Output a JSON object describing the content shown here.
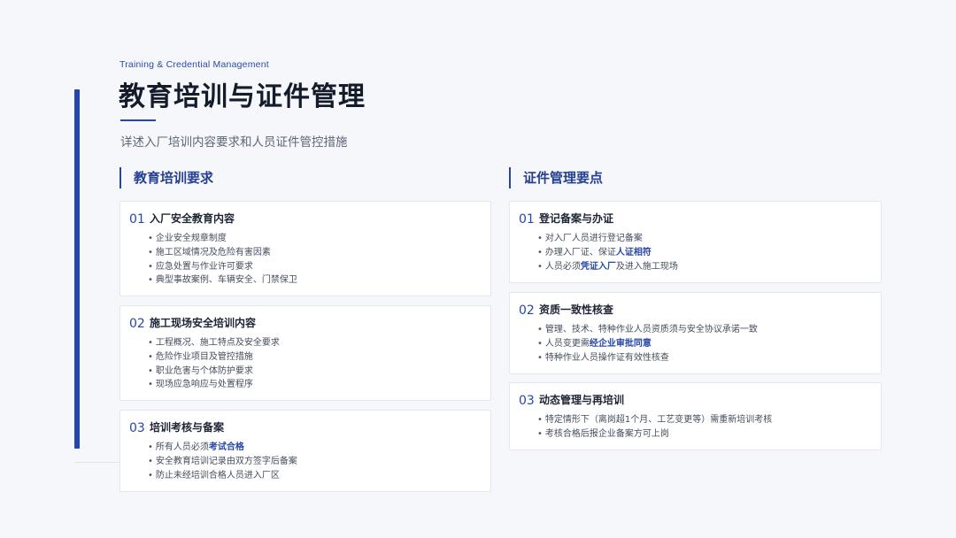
{
  "header": {
    "eyebrow": "Training & Credential Management",
    "title": "教育培训与证件管理",
    "subtitle": "详述入厂培训内容要求和人员证件管控措施"
  },
  "left": {
    "heading": "教育培训要求",
    "cards": [
      {
        "num": "01",
        "title": "入厂安全教育内容",
        "items": [
          {
            "pre": "企业安全规章制度",
            "hl": "",
            "post": ""
          },
          {
            "pre": "施工区域情况及危险有害因素",
            "hl": "",
            "post": ""
          },
          {
            "pre": "应急处置与作业许可要求",
            "hl": "",
            "post": ""
          },
          {
            "pre": "典型事故案例、车辆安全、门禁保卫",
            "hl": "",
            "post": ""
          }
        ]
      },
      {
        "num": "02",
        "title": "施工现场安全培训内容",
        "items": [
          {
            "pre": "工程概况、施工特点及安全要求",
            "hl": "",
            "post": ""
          },
          {
            "pre": "危险作业项目及管控措施",
            "hl": "",
            "post": ""
          },
          {
            "pre": "职业危害与个体防护要求",
            "hl": "",
            "post": ""
          },
          {
            "pre": "现场应急响应与处置程序",
            "hl": "",
            "post": ""
          }
        ]
      },
      {
        "num": "03",
        "title": "培训考核与备案",
        "items": [
          {
            "pre": "所有人员必须",
            "hl": "考试合格",
            "post": ""
          },
          {
            "pre": "安全教育培训记录由双方签字后备案",
            "hl": "",
            "post": ""
          },
          {
            "pre": "防止未经培训合格人员进入厂区",
            "hl": "",
            "post": ""
          }
        ]
      }
    ]
  },
  "right": {
    "heading": "证件管理要点",
    "cards": [
      {
        "num": "01",
        "title": "登记备案与办证",
        "items": [
          {
            "pre": "对入厂人员进行登记备案",
            "hl": "",
            "post": ""
          },
          {
            "pre": "办理入厂证、保证",
            "hl": "人证相符",
            "post": ""
          },
          {
            "pre": "人员必须",
            "hl": "凭证入厂",
            "post": "及进入施工现场"
          }
        ]
      },
      {
        "num": "02",
        "title": "资质一致性核查",
        "items": [
          {
            "pre": "管理、技术、特种作业人员资质须与安全协议承诺一致",
            "hl": "",
            "post": ""
          },
          {
            "pre": "人员变更需",
            "hl": "经企业审批同意",
            "post": ""
          },
          {
            "pre": "特种作业人员操作证有效性核查",
            "hl": "",
            "post": ""
          }
        ]
      },
      {
        "num": "03",
        "title": "动态管理与再培训",
        "items": [
          {
            "pre": "特定情形下（离岗超1个月、工艺变更等）需重新培训考核",
            "hl": "",
            "post": ""
          },
          {
            "pre": "考核合格后报企业备案方可上岗",
            "hl": "",
            "post": ""
          }
        ]
      }
    ]
  },
  "colors": {
    "accent": "#2747a8",
    "card_bg": "#ffffff",
    "page_bg": "#f5f7fb"
  }
}
